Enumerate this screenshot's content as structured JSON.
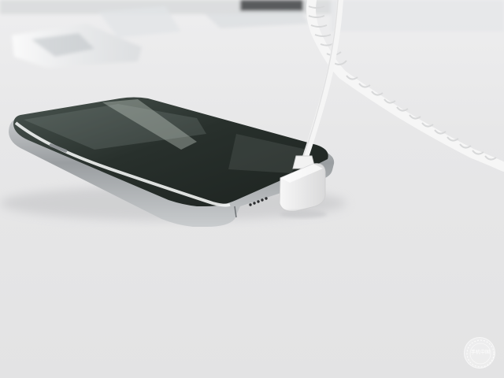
{
  "photo": {
    "subject": "smartphone-on-display-table",
    "accent_colors": {
      "table": "#e8e8e9",
      "phone_glass": "#2f3533",
      "phone_frame": "#b9bcbe",
      "cable": "#f4f4f4",
      "connector": "#ededee"
    }
  },
  "watermark": {
    "text": "手机中国"
  }
}
